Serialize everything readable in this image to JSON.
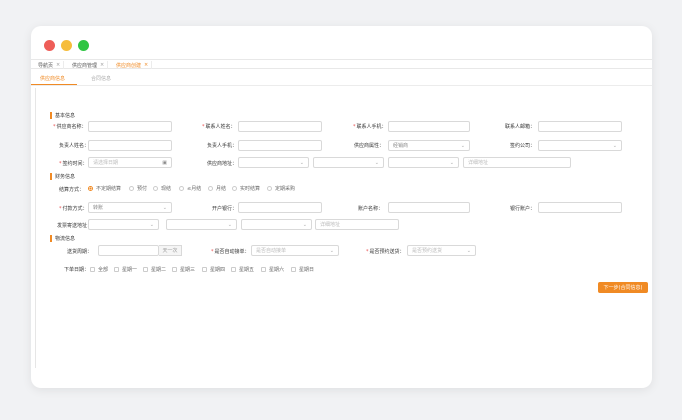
{
  "window_controls": {
    "close_color": "#ee5d58",
    "minimize_color": "#f6bd3b",
    "maximize_color": "#2fc543"
  },
  "tabs": [
    {
      "label": "导航页",
      "close": "×"
    },
    {
      "label": "供应商管理",
      "close": "×"
    },
    {
      "label": "供应商创建",
      "close": "×"
    }
  ],
  "subtabs": [
    {
      "label": "供应商信息"
    },
    {
      "label": "合同信息"
    }
  ],
  "sections": {
    "basic": "基本信息",
    "finance": "财务信息",
    "logistics": "物流信息"
  },
  "basic": {
    "supplier_name_label": "供应商名称：",
    "contact_name_label": "联系人姓名：",
    "contact_phone_label": "联系人手机：",
    "contact_email_label": "联系人邮箱：",
    "owner_name_label": "负责人姓名：",
    "owner_phone_label": "负责人手机：",
    "supplier_type_label": "供应商属性：",
    "supplier_type_value": "经销商",
    "sign_company_label": "签约公司：",
    "sign_date_label": "签约时间：",
    "sign_date_placeholder": "请选择日期",
    "address_label": "供应商地址：",
    "address_detail_placeholder": "详细地址"
  },
  "finance": {
    "settlement_label": "结算方式：",
    "settlement_options": [
      "不定期结算",
      "预付",
      "现结",
      "≤月结",
      "月结",
      "实时结算",
      "定期采购"
    ],
    "settlement_selected": 0,
    "payment_label": "付款方式：",
    "payment_value": "转账",
    "bank_label": "开户银行：",
    "account_name_label": "账户名称：",
    "bank_account_label": "银行账户：",
    "invoice_address_label": "发票寄送地址：",
    "invoice_detail_placeholder": "详细地址"
  },
  "logistics": {
    "delivery_cycle_label": "送货周期：",
    "delivery_cycle_suffix": "天一次",
    "auto_receive_label": "是否自动接单：",
    "auto_receive_placeholder": "是否自动接单",
    "appointment_label": "是否预约送货：",
    "appointment_placeholder": "是否预约送货",
    "order_day_label": "下单日期：",
    "order_days": [
      "全部",
      "星期一",
      "星期二",
      "星期三",
      "星期四",
      "星期五",
      "星期六",
      "星期日"
    ]
  },
  "next_button": "下一步(合同信息)",
  "colors": {
    "accent": "#f08a24",
    "required": "#e84d4d"
  }
}
